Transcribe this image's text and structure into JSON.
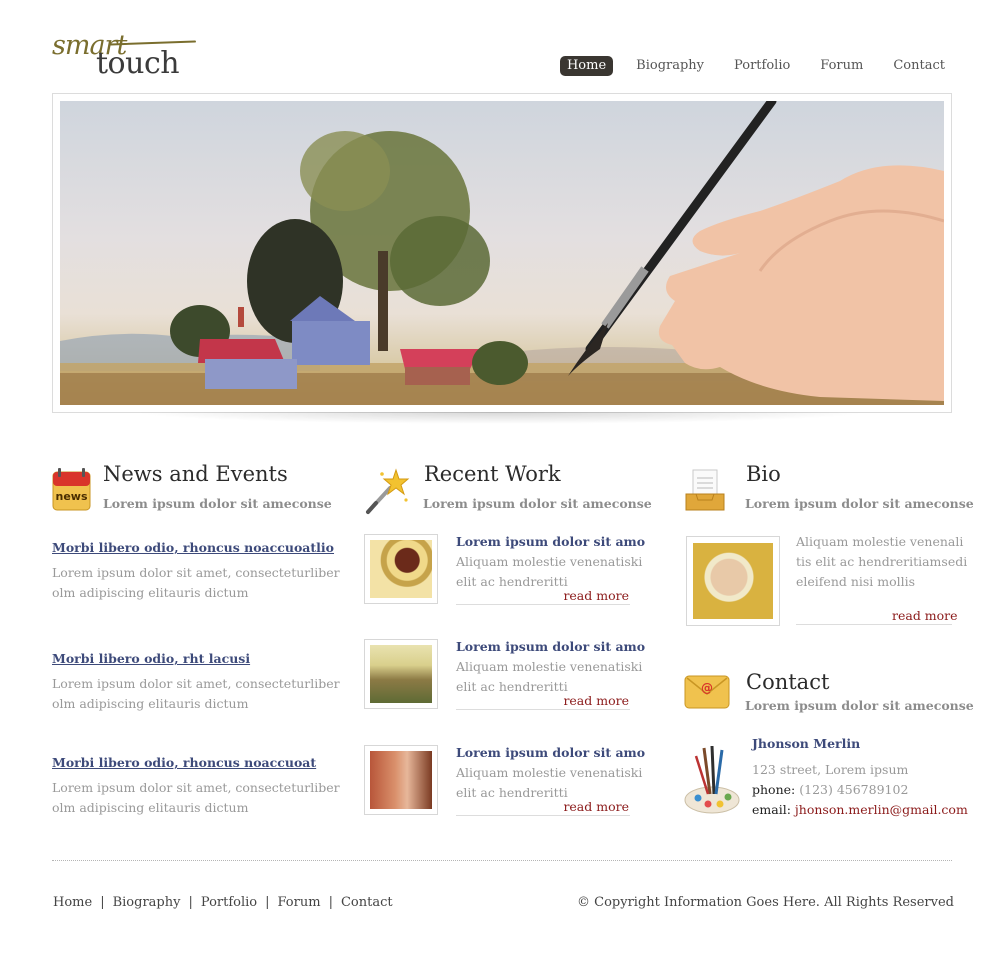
{
  "brand": {
    "script": "smart",
    "main": "touch"
  },
  "nav": [
    "Home",
    "Biography",
    "Portfolio",
    "Forum",
    "Contact"
  ],
  "news": {
    "title": "News and Events",
    "subtitle": "Lorem ipsum dolor sit ameconse",
    "icon_label": "news",
    "items": [
      {
        "title": "Morbi libero odio, rhoncus noaccuoatlio",
        "line1": "Lorem ipsum dolor sit amet, consecteturliber",
        "line2": "olm adipiscing elitauris dictum"
      },
      {
        "title": "Morbi libero odio, rht lacusi",
        "line1": "Lorem ipsum dolor sit amet, consecteturliber",
        "line2": "olm adipiscing elitauris dictum"
      },
      {
        "title": "Morbi libero odio, rhoncus noaccuoat",
        "line1": "Lorem ipsum dolor sit amet, consecteturliber",
        "line2": "olm adipiscing elitauris dictum"
      }
    ]
  },
  "recent_work": {
    "title": "Recent Work",
    "subtitle": "Lorem ipsum dolor sit ameconse",
    "items": [
      {
        "title": "Lorem ipsum dolor sit amo",
        "line1": "Aliquam molestie venenatiski",
        "line2": "elit ac hendreritti",
        "more": "read more"
      },
      {
        "title": "Lorem ipsum dolor sit amo",
        "line1": "Aliquam molestie venenatiski",
        "line2": "elit ac hendreritti",
        "more": "read more"
      },
      {
        "title": "Lorem ipsum dolor sit amo",
        "line1": "Aliquam molestie venenatiski",
        "line2": "elit ac hendreritti",
        "more": "read more"
      }
    ]
  },
  "bio": {
    "title": "Bio",
    "subtitle": "Lorem ipsum dolor sit ameconse",
    "line1": "Aliquam molestie venenali",
    "line2": "tis elit ac hendreritiamsedi",
    "line3": "eleifend nisi mollis",
    "more": "read more"
  },
  "contact": {
    "title": "Contact",
    "subtitle": "Lorem ipsum dolor sit ameconse",
    "name": "Jhonson Merlin",
    "address": "123 street, Lorem ipsum",
    "phone_label": "phone:",
    "phone": "(123) 456789102",
    "email_label": "email:",
    "email": "jhonson.merlin@gmail.com"
  },
  "footer": {
    "links": [
      "Home",
      "Biography",
      "Portfolio",
      "Forum",
      "Contact"
    ],
    "separator": "|",
    "copyright": "© Copyright Information Goes Here. All Rights Reserved"
  },
  "colors": {
    "nav_active_bg": "#3a3631",
    "link_blue": "#3d4a7a",
    "read_more": "#8b1a1a",
    "logo_olive": "#7a6e2e"
  }
}
